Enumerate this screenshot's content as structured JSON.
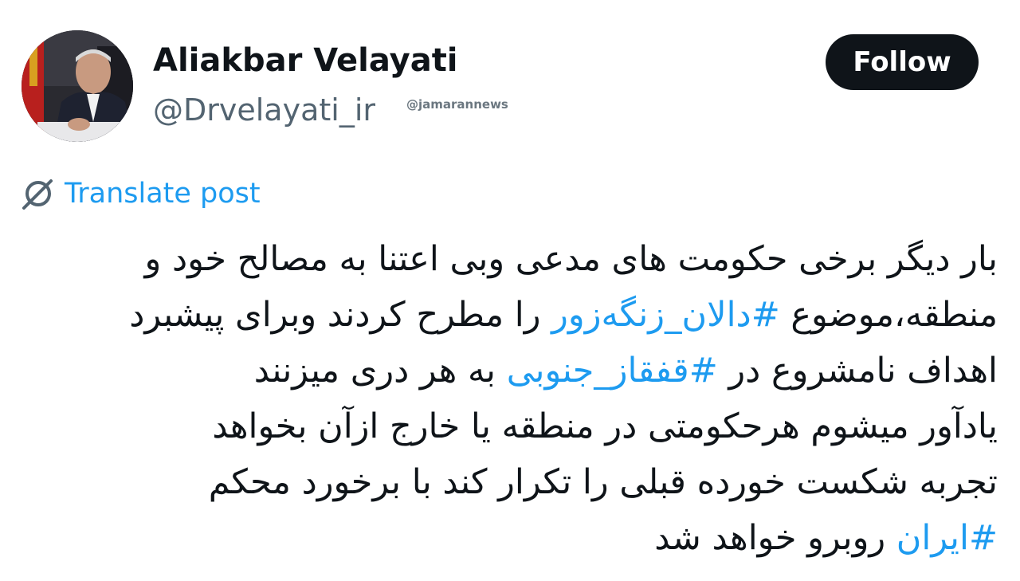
{
  "author": {
    "display_name": "Aliakbar Velayati",
    "handle": "@Drvelayati_ir",
    "avatar_icon": "profile-photo"
  },
  "watermark": "@jamarannews",
  "follow_button": {
    "label": "Follow"
  },
  "translate": {
    "icon": "translate-globe-icon",
    "label": "Translate post"
  },
  "post": {
    "lines": [
      {
        "segments": [
          {
            "text": "بار دیگر برخی حکومت های مدعی وبی اعتنا به مصالح خود و"
          }
        ]
      },
      {
        "segments": [
          {
            "text": "منطقه،موضوع "
          },
          {
            "text": "#دالان_زنگه‌زور",
            "hashtag": true
          },
          {
            "text": " را مطرح کردند وبرای پیشبرد"
          }
        ]
      },
      {
        "segments": [
          {
            "text": "اهداف نامشروع در  "
          },
          {
            "text": "#قفقاز_جنوبی",
            "hashtag": true
          },
          {
            "text": " به هر دری میزنند"
          }
        ]
      },
      {
        "segments": [
          {
            "text": "یادآور میشوم هرحکومتی در منطقه یا خارج ازآن بخواهد"
          }
        ]
      },
      {
        "segments": [
          {
            "text": "تجربه شکست خورده قبلی را تکرار کند با برخورد محکم"
          }
        ]
      },
      {
        "segments": [
          {
            "text": "#ایران",
            "hashtag": true
          },
          {
            "text": " روبرو خواهد شد"
          }
        ]
      }
    ]
  },
  "colors": {
    "link": "#1d9bf0",
    "text": "#0f1419",
    "secondary": "#536471",
    "button_bg": "#0f1419",
    "button_text": "#ffffff"
  }
}
